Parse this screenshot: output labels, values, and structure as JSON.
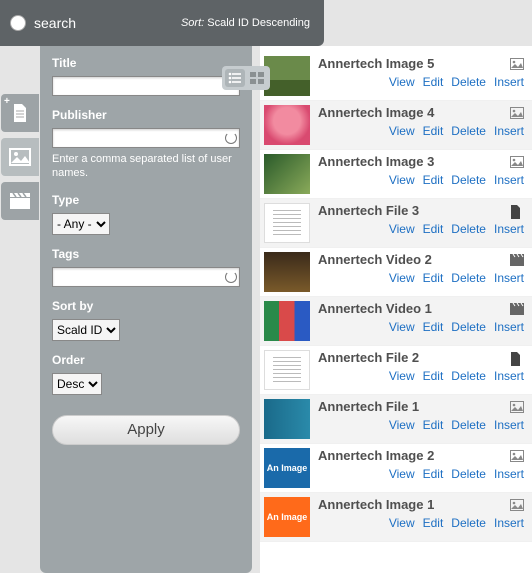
{
  "header": {
    "search_placeholder": "search",
    "sort_prefix": "Sort:",
    "sort_value": "Scald ID Descending"
  },
  "left_tabs": {
    "add_doc": "Add document",
    "images": "Images library",
    "videos": "Videos library"
  },
  "filters": {
    "title_label": "Title",
    "title_value": "",
    "publisher_label": "Publisher",
    "publisher_value": "",
    "publisher_hint": "Enter a comma separated list of user names.",
    "type_label": "Type",
    "type_value": "- Any -",
    "tags_label": "Tags",
    "tags_value": "",
    "sortby_label": "Sort by",
    "sortby_value": "Scald ID",
    "order_label": "Order",
    "order_value": "Desc",
    "apply_label": "Apply"
  },
  "actions": {
    "view": "View",
    "edit": "Edit",
    "delete": "Delete",
    "insert": "Insert"
  },
  "items": [
    {
      "title": "Annertech Image 5",
      "type": "image",
      "thumb": "th-img1"
    },
    {
      "title": "Annertech Image 4",
      "type": "image",
      "thumb": "th-img2"
    },
    {
      "title": "Annertech Image 3",
      "type": "image",
      "thumb": "th-img3"
    },
    {
      "title": "Annertech File 3",
      "type": "file",
      "thumb": "th-file"
    },
    {
      "title": "Annertech Video 2",
      "type": "video",
      "thumb": "th-vid1"
    },
    {
      "title": "Annertech Video 1",
      "type": "video",
      "thumb": "th-vid2"
    },
    {
      "title": "Annertech File 2",
      "type": "file",
      "thumb": "th-file"
    },
    {
      "title": "Annertech File 1",
      "type": "image",
      "thumb": "th-img4"
    },
    {
      "title": "Annertech Image 2",
      "type": "image",
      "thumb": "th-animage2",
      "label": "An Image"
    },
    {
      "title": "Annertech Image 1",
      "type": "image",
      "thumb": "th-animage1",
      "label": "An Image"
    }
  ]
}
